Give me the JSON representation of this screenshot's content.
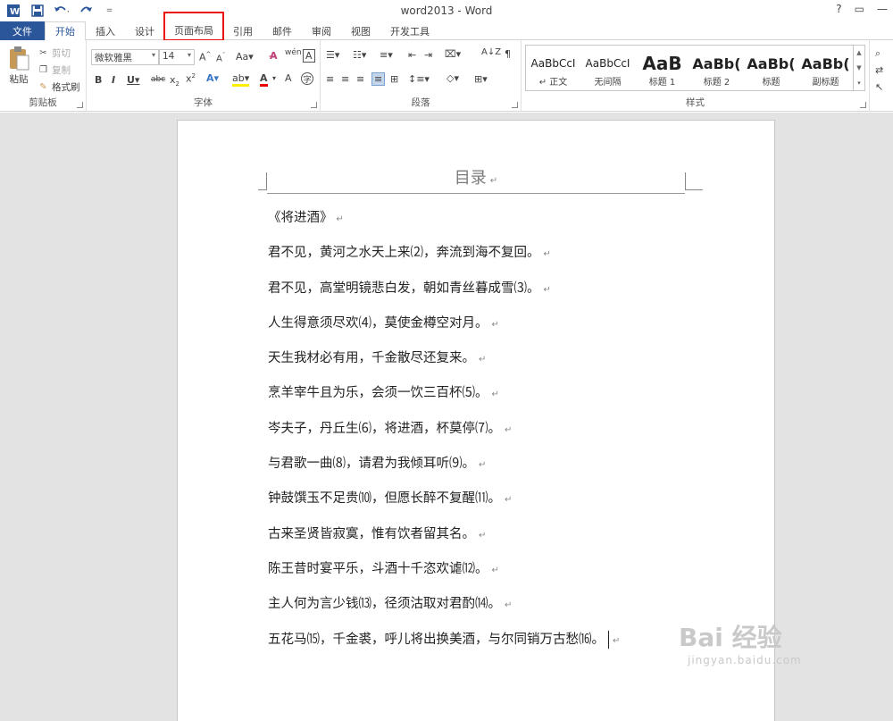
{
  "titlebar": {
    "title": "word2013 - Word",
    "help": "?",
    "restore": "▭",
    "minimize": "—"
  },
  "tabs": [
    "文件",
    "开始",
    "插入",
    "设计",
    "页面布局",
    "引用",
    "邮件",
    "审阅",
    "视图",
    "开发工具"
  ],
  "ribbon": {
    "clipboard": {
      "label": "剪贴板",
      "paste": "粘贴",
      "cut": "剪切",
      "copy": "复制",
      "format_painter": "格式刷"
    },
    "font": {
      "label": "字体",
      "font_name": "微软雅黑",
      "font_size": "14"
    },
    "paragraph": {
      "label": "段落"
    },
    "styles": {
      "label": "样式",
      "items": [
        {
          "preview": "AaBbCcI",
          "name": "↵ 正文"
        },
        {
          "preview": "AaBbCcI",
          "name": "无间隔"
        },
        {
          "preview": "AaB",
          "name": "标题 1"
        },
        {
          "preview": "AaBb(",
          "name": "标题 2"
        },
        {
          "preview": "AaBb(",
          "name": "标题"
        },
        {
          "preview": "AaBb(",
          "name": "副标题"
        }
      ]
    }
  },
  "document": {
    "toc_title": "目录",
    "lines": [
      "《将进酒》",
      "君不见，黄河之水天上来⑵，奔流到海不复回。",
      "君不见，高堂明镜悲白发，朝如青丝暮成雪⑶。",
      "人生得意须尽欢⑷，莫使金樽空对月。",
      "天生我材必有用，千金散尽还复来。",
      "烹羊宰牛且为乐，会须一饮三百杯⑸。",
      "岑夫子，丹丘生⑹，将进酒，杯莫停⑺。",
      "与君歌一曲⑻，请君为我倾耳听⑼。",
      "钟鼓馔玉不足贵⑽，但愿长醉不复醒⑾。",
      "古来圣贤皆寂寞，惟有饮者留其名。",
      "陈王昔时宴平乐，斗酒十千恣欢谑⑿。",
      "主人何为言少钱⒀，径须沽取对君酌⒁。",
      "五花马⒂，千金裘，呼儿将出换美酒，与尔同销万古愁⒃。"
    ]
  },
  "watermark": {
    "brand": "Bai 经验",
    "url": "jingyan.baidu.com"
  },
  "colors": {
    "accent": "#2b579a",
    "highlight_box": "#ee1111"
  }
}
